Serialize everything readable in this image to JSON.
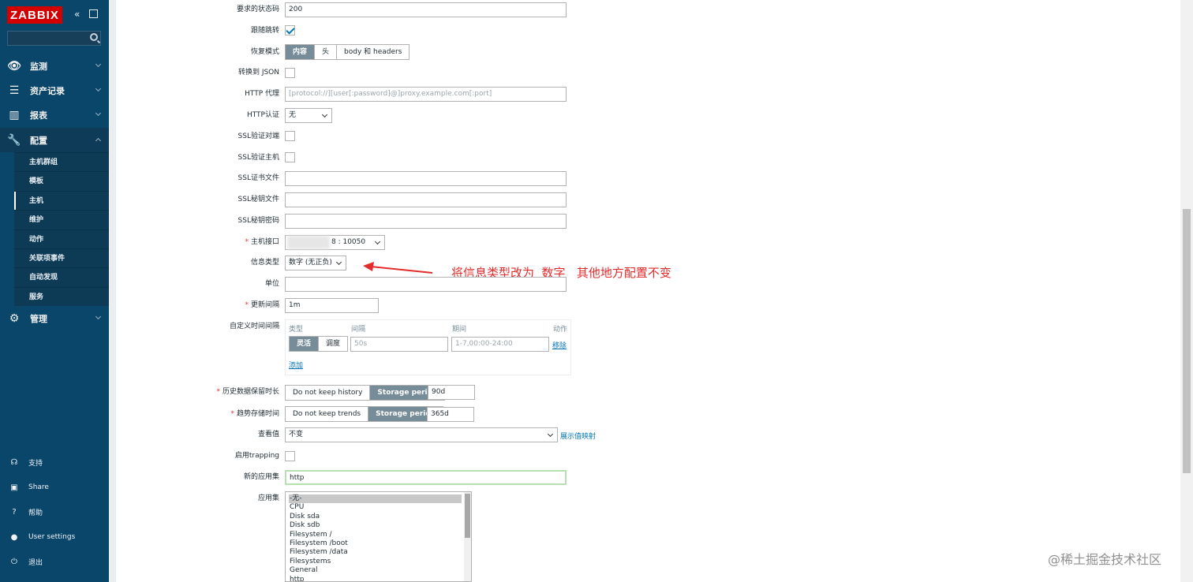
{
  "sidebar": {
    "logo": "ZABBIX",
    "collapse_icon": "double-chevron-left-icon",
    "kiosk_icon": "fullscreen-icon",
    "menu": [
      {
        "label": "监测",
        "icon": "eye-icon"
      },
      {
        "label": "资产记录",
        "icon": "list-icon"
      },
      {
        "label": "报表",
        "icon": "bar-chart-icon"
      },
      {
        "label": "配置",
        "icon": "wrench-icon"
      },
      {
        "label": "管理",
        "icon": "gear-icon"
      }
    ],
    "submenu": [
      "主机群组",
      "模板",
      "主机",
      "维护",
      "动作",
      "关联项事件",
      "自动发现",
      "服务"
    ],
    "footer": [
      {
        "label": "支持",
        "icon": "headset-icon"
      },
      {
        "label": "Share",
        "icon": "share-icon"
      },
      {
        "label": "帮助",
        "icon": "help-icon"
      },
      {
        "label": "User settings",
        "icon": "user-icon"
      },
      {
        "label": "退出",
        "icon": "power-icon"
      }
    ]
  },
  "form": {
    "status_codes": {
      "label": "要求的状态码",
      "value": "200"
    },
    "follow_redirects": {
      "label": "跟随跳转",
      "checked": true
    },
    "retrieve_mode": {
      "label": "恢复模式",
      "options": [
        "内容",
        "头",
        "body 和 headers"
      ],
      "selected": "内容"
    },
    "convert_json": {
      "label": "转换到 JSON",
      "checked": false
    },
    "http_proxy": {
      "label": "HTTP 代理",
      "placeholder": "[protocol://][user[:password]@]proxy.example.com[:port]"
    },
    "http_auth": {
      "label": "HTTP认证",
      "value": "无"
    },
    "ssl_verify_peer": {
      "label": "SSL验证对端",
      "checked": false
    },
    "ssl_verify_host": {
      "label": "SSL验证主机",
      "checked": false
    },
    "ssl_cert": {
      "label": "SSL证书文件",
      "value": ""
    },
    "ssl_key": {
      "label": "SSL秘钥文件",
      "value": ""
    },
    "ssl_pass": {
      "label": "SSL秘钥密码",
      "value": ""
    },
    "host_interface": {
      "label": "主机接口",
      "value": "8 : 10050"
    },
    "info_type": {
      "label": "信息类型",
      "value": "数字 (无正负)"
    },
    "units": {
      "label": "单位",
      "value": ""
    },
    "update_interval": {
      "label": "更新间隔",
      "value": "1m"
    },
    "custom_intervals": {
      "label": "自定义时间间隔",
      "headers": [
        "类型",
        "间隔",
        "期间",
        "动作"
      ],
      "type_options": [
        "灵活",
        "调度"
      ],
      "selected": "灵活",
      "interval": "50s",
      "period": "1-7,00:00-24:00",
      "remove": "移除",
      "add": "添加"
    },
    "history": {
      "label": "历史数据保留时长",
      "options": [
        "Do not keep history",
        "Storage period"
      ],
      "selected": "Storage period",
      "value": "90d"
    },
    "trends": {
      "label": "趋势存储时间",
      "options": [
        "Do not keep trends",
        "Storage period"
      ],
      "selected": "Storage period",
      "value": "365d"
    },
    "show_value": {
      "label": "查看值",
      "value": "不变",
      "link": "展示值映射"
    },
    "trapping": {
      "label": "启用trapping",
      "checked": false
    },
    "new_application": {
      "label": "新的应用集",
      "value": "http"
    },
    "applications": {
      "label": "应用集",
      "items": [
        "-无-",
        "CPU",
        "Disk sda",
        "Disk sdb",
        "Filesystem /",
        "Filesystem /boot",
        "Filesystem /data",
        "Filesystems",
        "General",
        "http"
      ]
    }
  },
  "annotation": "将信息类型改为  数字   其他地方配置不变",
  "watermark": "@稀土掘金技术社区"
}
